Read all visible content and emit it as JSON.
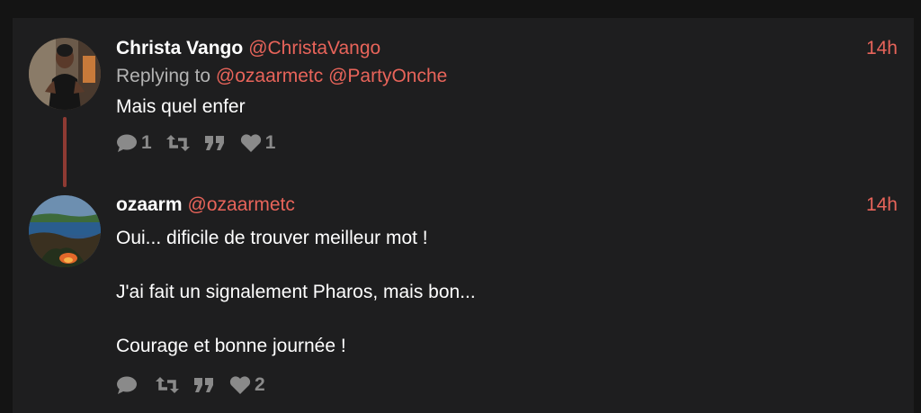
{
  "tweets": [
    {
      "name": "Christa Vango",
      "handle": "@ChristaVango",
      "time": "14h",
      "reply_prefix": "Replying to",
      "reply_mentions": [
        "@ozaarmetc",
        "@PartyOnche"
      ],
      "text_lines": [
        "Mais quel enfer"
      ],
      "actions": {
        "reply_count": "1",
        "retweet_count": "",
        "quote_count": "",
        "like_count": "1"
      },
      "avatar_icon": "person-avatar"
    },
    {
      "name": "ozaarm",
      "handle": "@ozaarmetc",
      "time": "14h",
      "text_lines": [
        "Oui... dificile de trouver meilleur mot !",
        "",
        "J'ai fait un signalement Pharos, mais bon...",
        "",
        "Courage et bonne journée !"
      ],
      "actions": {
        "reply_count": "",
        "retweet_count": "",
        "quote_count": "",
        "like_count": "2"
      },
      "avatar_icon": "landscape-avatar"
    }
  ],
  "colors": {
    "background": "#141414",
    "panel": "#1e1e1f",
    "accent": "#e8645a",
    "thread_line": "#8e3a33",
    "muted": "#8a8a8a"
  },
  "icons": [
    "reply-icon",
    "retweet-icon",
    "quote-icon",
    "heart-icon"
  ]
}
